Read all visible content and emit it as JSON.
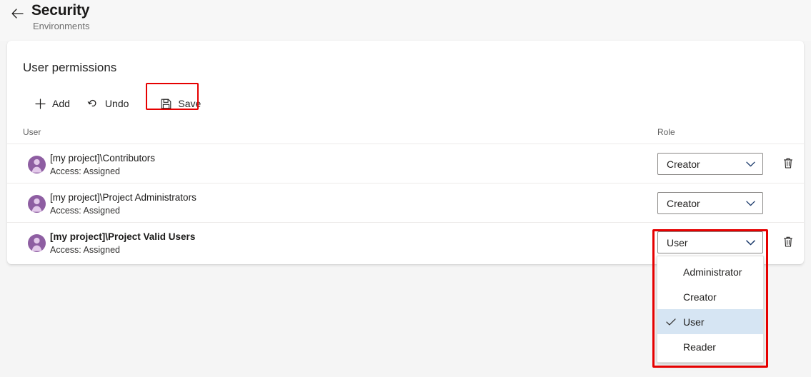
{
  "header": {
    "back_icon": "arrow-left-icon",
    "title": "Security",
    "subtitle": "Environments"
  },
  "card": {
    "title": "User permissions"
  },
  "toolbar": {
    "add_label": "Add",
    "add_icon": "plus-icon",
    "undo_label": "Undo",
    "undo_icon": "undo-arrow-icon",
    "save_label": "Save",
    "save_icon": "floppy-disk-icon",
    "highlight_color": "#e60000"
  },
  "table": {
    "columns": {
      "user": "User",
      "role": "Role"
    },
    "rows": [
      {
        "avatar_icon": "user-avatar-icon",
        "name": "[my project]\\Contributors",
        "access": "Access: Assigned",
        "bold": false,
        "role": "Creator",
        "has_delete": true,
        "delete_icon": "trash-icon",
        "chevron_icon": "chevron-down-icon"
      },
      {
        "avatar_icon": "user-avatar-icon",
        "name": "[my project]\\Project Administrators",
        "access": "Access: Assigned",
        "bold": false,
        "role": "Creator",
        "has_delete": false,
        "delete_icon": "trash-icon",
        "chevron_icon": "chevron-down-icon"
      },
      {
        "avatar_icon": "user-avatar-icon",
        "name": "[my project]\\Project Valid Users",
        "access": "Access: Assigned",
        "bold": true,
        "role": "User",
        "has_delete": true,
        "delete_icon": "trash-icon",
        "chevron_icon": "chevron-down-icon"
      }
    ]
  },
  "role_dropdown": {
    "open": true,
    "selected": "User",
    "check_icon": "checkmark-icon",
    "highlight_color": "#e60000",
    "selected_bg": "#d6e5f3",
    "options": [
      {
        "label": "Administrator",
        "selected": false
      },
      {
        "label": "Creator",
        "selected": false
      },
      {
        "label": "User",
        "selected": true
      },
      {
        "label": "Reader",
        "selected": false
      }
    ]
  },
  "colors": {
    "page_bg": "#f5f5f5",
    "card_bg": "#ffffff",
    "avatar_purple": "#8e5ea2",
    "text_primary": "#1b1a19",
    "text_secondary": "#6e6e6e"
  }
}
